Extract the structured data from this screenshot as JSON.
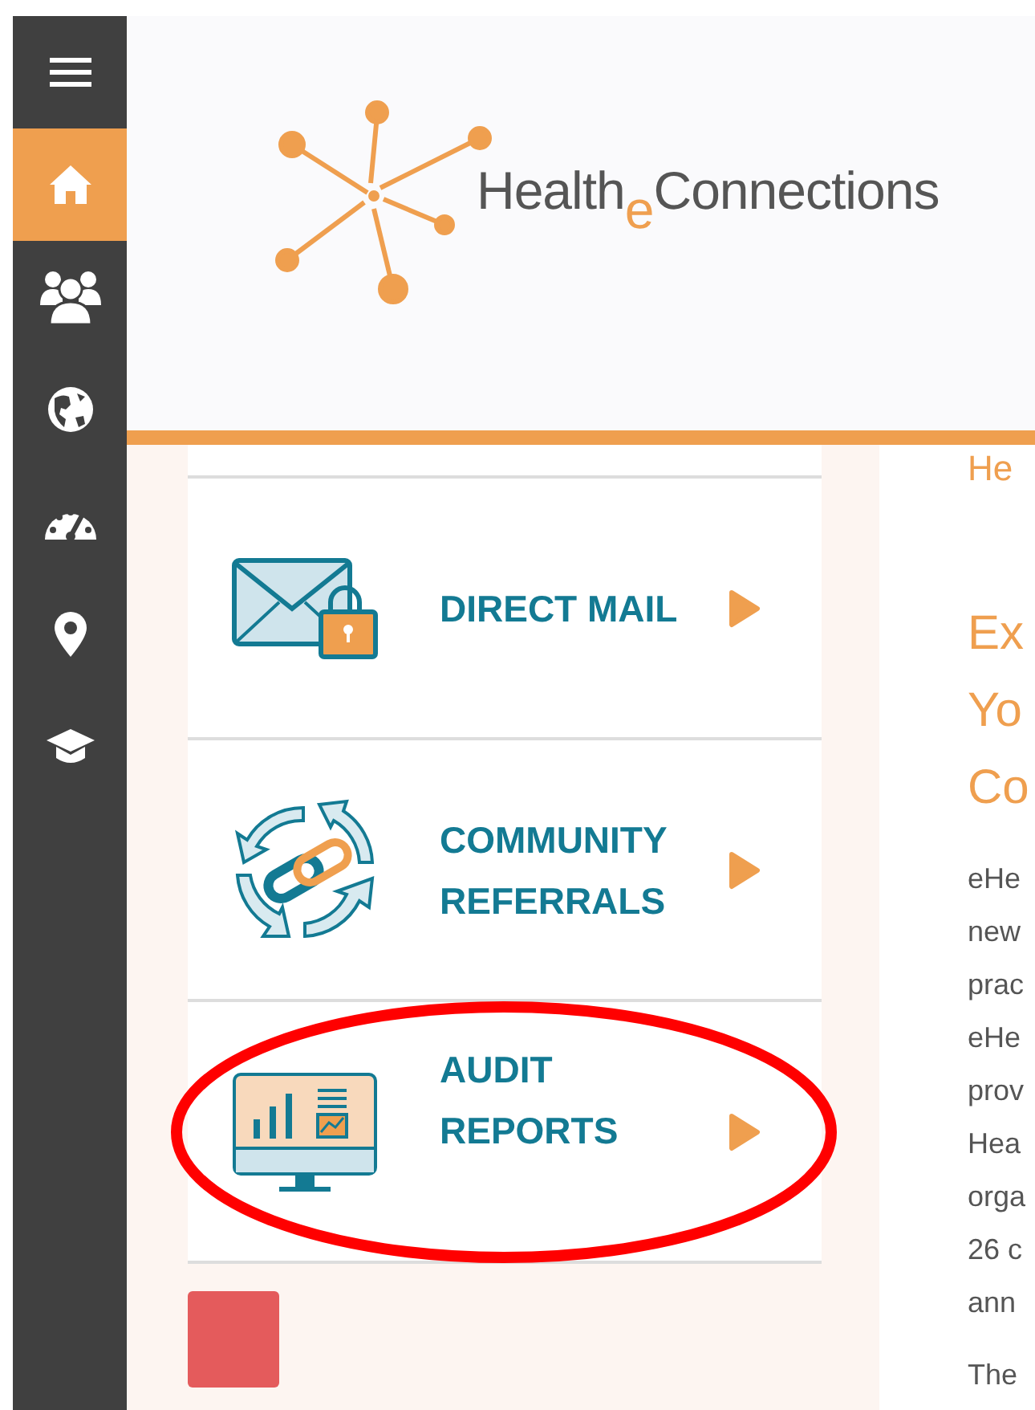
{
  "sidebar": {
    "items": [
      {
        "kind": "menu",
        "selected": false
      },
      {
        "kind": "home",
        "selected": true
      },
      {
        "kind": "people",
        "selected": false
      },
      {
        "kind": "globe",
        "selected": false
      },
      {
        "kind": "dashboard",
        "selected": false
      },
      {
        "kind": "pin",
        "selected": false
      },
      {
        "kind": "cap",
        "selected": false
      }
    ]
  },
  "header": {
    "logo_text": "Health$_{e}$Connections"
  },
  "services": [
    {
      "kind": "mail",
      "title_lines": [
        "DIRECT MAIL"
      ],
      "annotated": false
    },
    {
      "kind": "referral",
      "title_lines": [
        "COMMUNITY",
        "REFERRALS"
      ],
      "annotated": false
    },
    {
      "kind": "report",
      "title_lines": [
        "AUDIT",
        "REPORTS"
      ],
      "annotated": true
    }
  ],
  "article": {
    "top_line": "He",
    "heading_lines": [
      "Ex",
      "Yo",
      "Co"
    ],
    "body_lines": [
      "eHe",
      "new",
      "prac",
      "eHe",
      "prov",
      "Hea",
      "orga",
      "26 c",
      "ann"
    ],
    "next_line": "The"
  }
}
